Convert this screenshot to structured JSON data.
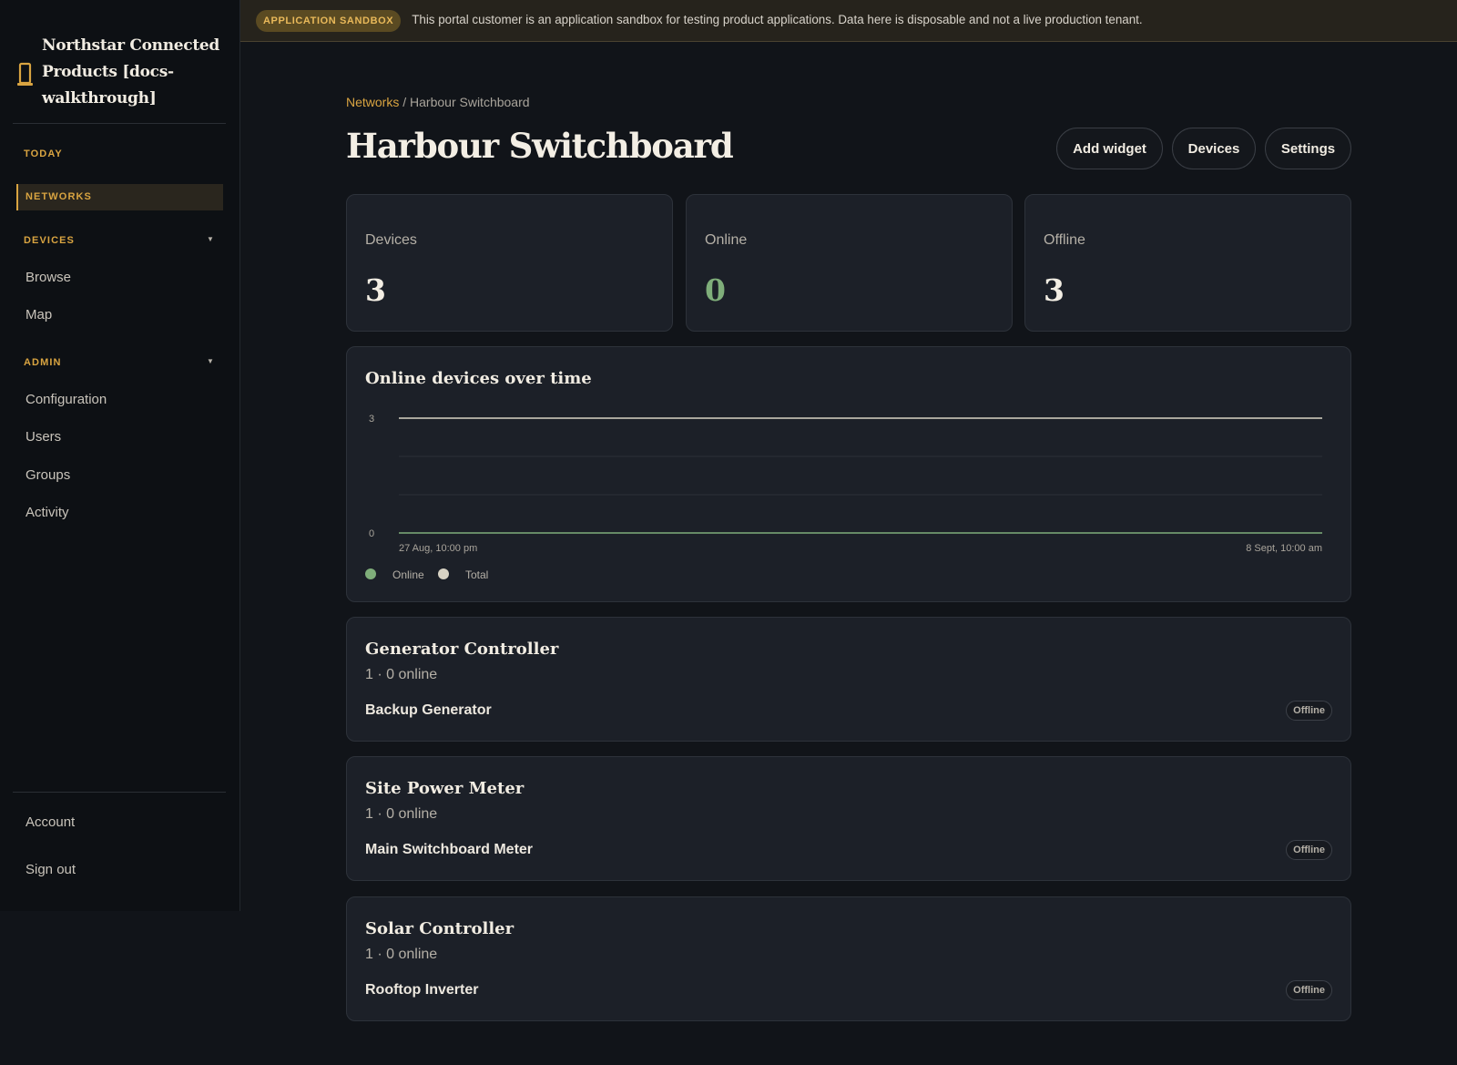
{
  "sidebar": {
    "brand_title": "Northstar Connected Products [docs-walkthrough]",
    "brand_icon": "device-icon",
    "today_label": "TODAY",
    "networks_label": "NETWORKS",
    "devices_section": "DEVICES",
    "devices_items": [
      "Browse",
      "Map"
    ],
    "admin_section": "ADMIN",
    "admin_items": [
      "Configuration",
      "Users",
      "Groups",
      "Activity"
    ],
    "account_label": "Account",
    "signout_label": "Sign out",
    "accent_color": "#d9a441"
  },
  "banner": {
    "badge": "APPLICATION SANDBOX",
    "text": "This portal customer is an application sandbox for testing product applications. Data here is disposable and not a live production tenant."
  },
  "breadcrumb": {
    "parent": "Networks",
    "separator": " / ",
    "current": "Harbour Switchboard"
  },
  "page_title": "Harbour Switchboard",
  "actions": {
    "add_widget": "Add widget",
    "devices": "Devices",
    "settings": "Settings"
  },
  "stats": [
    {
      "label": "Devices",
      "value": "3"
    },
    {
      "label": "Online",
      "value": "0"
    },
    {
      "label": "Offline",
      "value": "3"
    }
  ],
  "chart_data": {
    "type": "line",
    "title": "Online devices over time",
    "x_start_label": "27 Aug, 10:00 pm",
    "x_end_label": "8 Sept, 10:00 am",
    "x": [
      "27 Aug, 10:00 pm",
      "8 Sept, 10:00 am"
    ],
    "ylim": [
      0,
      3
    ],
    "y_ticks": [
      "3",
      "0"
    ],
    "grid": true,
    "legend_placement": "bottom-left",
    "series": [
      {
        "name": "Online",
        "values": [
          0,
          0
        ],
        "color": "#7fae7a"
      },
      {
        "name": "Total",
        "values": [
          3,
          3
        ],
        "color": "#d8d3c4"
      }
    ]
  },
  "device_groups": [
    {
      "title": "Generator Controller",
      "subtitle": "1 · 0 online",
      "device": "Backup Generator",
      "status": "Offline"
    },
    {
      "title": "Site Power Meter",
      "subtitle": "1 · 0 online",
      "device": "Main Switchboard Meter",
      "status": "Offline"
    },
    {
      "title": "Solar Controller",
      "subtitle": "1 · 0 online",
      "device": "Rooftop Inverter",
      "status": "Offline"
    }
  ]
}
